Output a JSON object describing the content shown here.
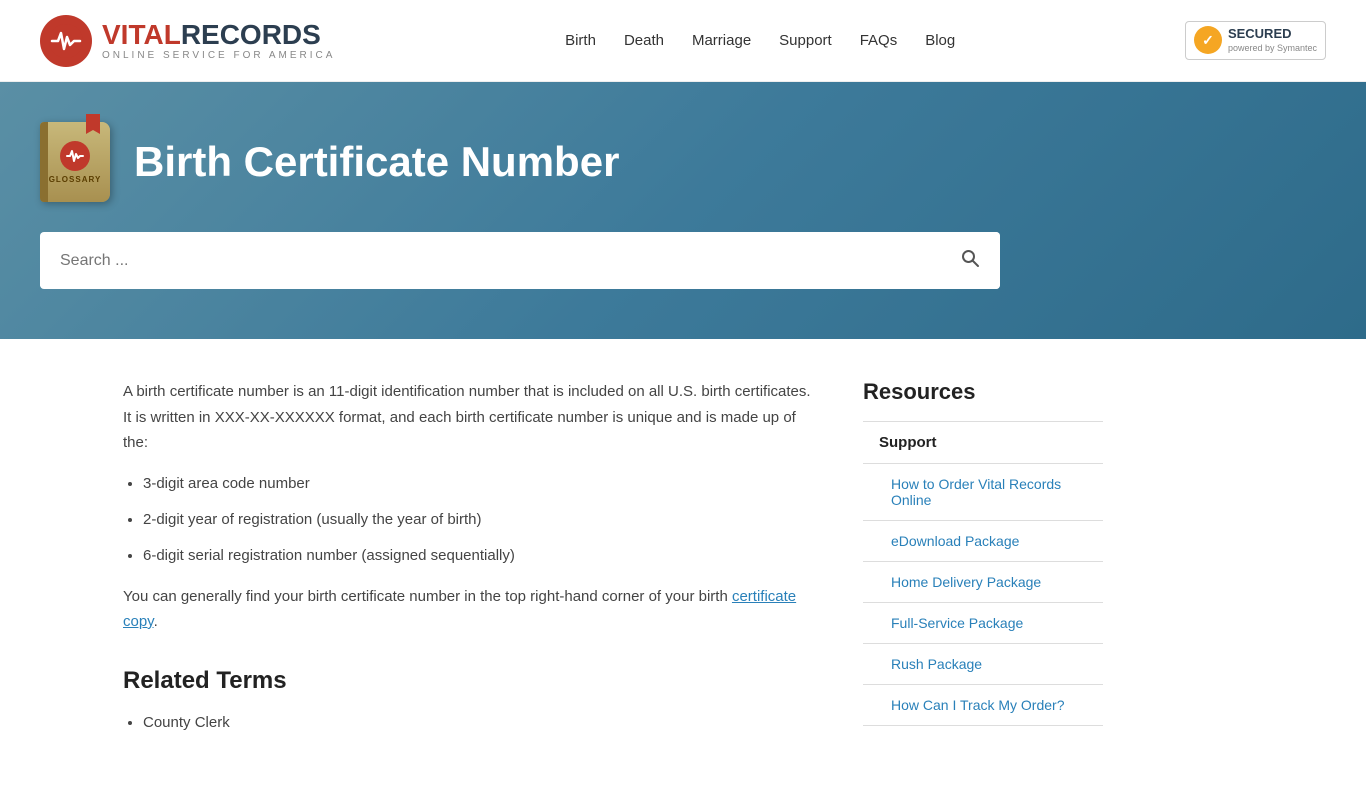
{
  "header": {
    "logo_vital": "VITAL",
    "logo_records": "RECORDS",
    "logo_sub": "ONLINE SERVICE FOR AMERICA",
    "nav": {
      "birth": "Birth",
      "death": "Death",
      "marriage": "Marriage",
      "support": "Support",
      "faqs": "FAQs",
      "blog": "Blog"
    },
    "norton": {
      "secured": "SECURED",
      "powered": "powered by Symantec"
    }
  },
  "hero": {
    "title": "Birth Certificate Number",
    "book_label": "GLOSSARY",
    "search_placeholder": "Search ..."
  },
  "article": {
    "intro": "A birth certificate number is an 11-digit identification number that is included on all U.S. birth certificates. It is written in XXX-XX-XXXXXX format, and each birth certificate number is unique and is made up of the:",
    "bullet1": "3-digit area code number",
    "bullet2": "2-digit year of registration (usually the year of birth)",
    "bullet3": "6-digit serial registration number (assigned sequentially)",
    "location_text": "You can generally find your birth certificate number in the top right-hand corner of your birth ",
    "location_link": "certificate copy",
    "location_end": ".",
    "related_title": "Related Terms",
    "related_item1": "County Clerk"
  },
  "sidebar": {
    "title": "Resources",
    "items": [
      {
        "label": "Support",
        "type": "parent"
      },
      {
        "label": "How to Order Vital Records Online",
        "type": "child"
      },
      {
        "label": "eDownload Package",
        "type": "child"
      },
      {
        "label": "Home Delivery Package",
        "type": "child"
      },
      {
        "label": "Full-Service Package",
        "type": "child"
      },
      {
        "label": "Rush Package",
        "type": "child"
      },
      {
        "label": "How Can I Track My Order?",
        "type": "child"
      }
    ]
  }
}
